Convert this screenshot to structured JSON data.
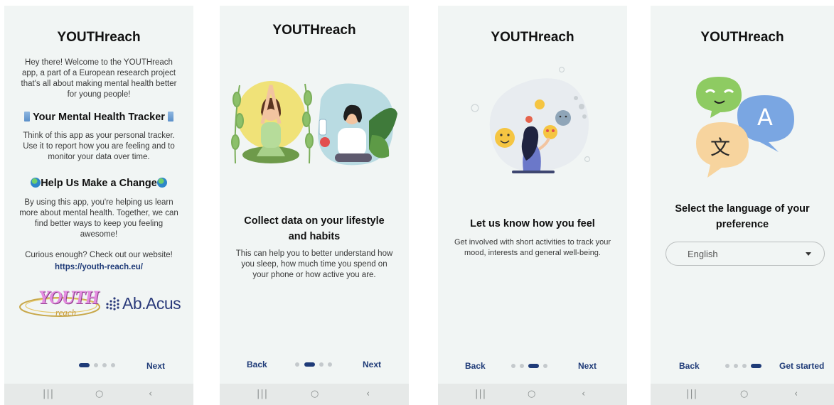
{
  "app_name": "YOUTHreach",
  "screen1": {
    "intro": "Hey there! Welcome to the YOUTHreach app, a part of a European research project that's all about making mental health better for young people!",
    "tracker_heading": "Your Mental Health Tracker",
    "tracker_text": "Think of this app as your personal tracker. Use it to report how you are feeling and to monitor your data over time.",
    "change_heading": "Help Us Make a Change",
    "change_text": "By using this app, you're helping us learn more about mental health. Together, we can find better ways to keep you feeling awesome!",
    "curious_text": "Curious enough? Check out our website!",
    "website": "https://youth-reach.eu/",
    "logo_youth": "YOUTH",
    "logo_reach": "reach",
    "logo_abacus": "Ab.Acus",
    "next": "Next"
  },
  "screen2": {
    "heading": "Collect data on your lifestyle and habits",
    "text": "This can help you to better understand how you sleep, how much time you spend on your phone or how active you are.",
    "back": "Back",
    "next": "Next"
  },
  "screen3": {
    "heading": "Let us know how you feel",
    "text": "Get involved with short activities to track your mood, interests and general well-being.",
    "back": "Back",
    "next": "Next"
  },
  "screen4": {
    "heading": "Select the language of your preference",
    "language_value": "English",
    "bubble_char_1": "文",
    "bubble_char_2": "A",
    "back": "Back",
    "get_started": "Get started"
  },
  "navbar": {
    "recents": "|||",
    "home": "○",
    "back": "‹"
  },
  "pager": {
    "total": 4
  },
  "colors": {
    "accent": "#1f3b78",
    "screen_bg": "#f1f5f4",
    "navbar_bg": "#e6e9e8"
  },
  "icons": [
    "mobile-phone-icon",
    "globe-icon",
    "dropdown-caret-icon",
    "recents-icon",
    "home-icon",
    "system-back-icon"
  ]
}
